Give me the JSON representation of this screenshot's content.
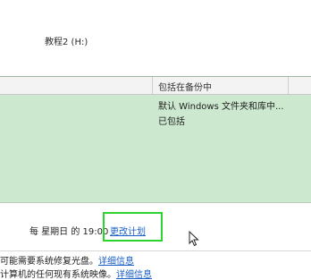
{
  "backup_location": "教程2 (H:)",
  "contents_list": {
    "column_header": "包括在备份中",
    "rows": [
      "默认 Windows 文件夹和库中...",
      "已包括"
    ]
  },
  "schedule": {
    "text": "每 星期日 的 19:00",
    "change_link": "更改计划"
  },
  "info": [
    {
      "text": "可能需要系统修复光盘。",
      "link": "详细信息"
    },
    {
      "text": "计算机的任何现有系统映像。",
      "link": "详细信息"
    }
  ],
  "icons": {
    "cursor": "mouse-pointer-icon"
  },
  "colors": {
    "list_background": "#cce8cf",
    "highlight_border": "#2ed42e",
    "link": "#1a5fc7"
  }
}
